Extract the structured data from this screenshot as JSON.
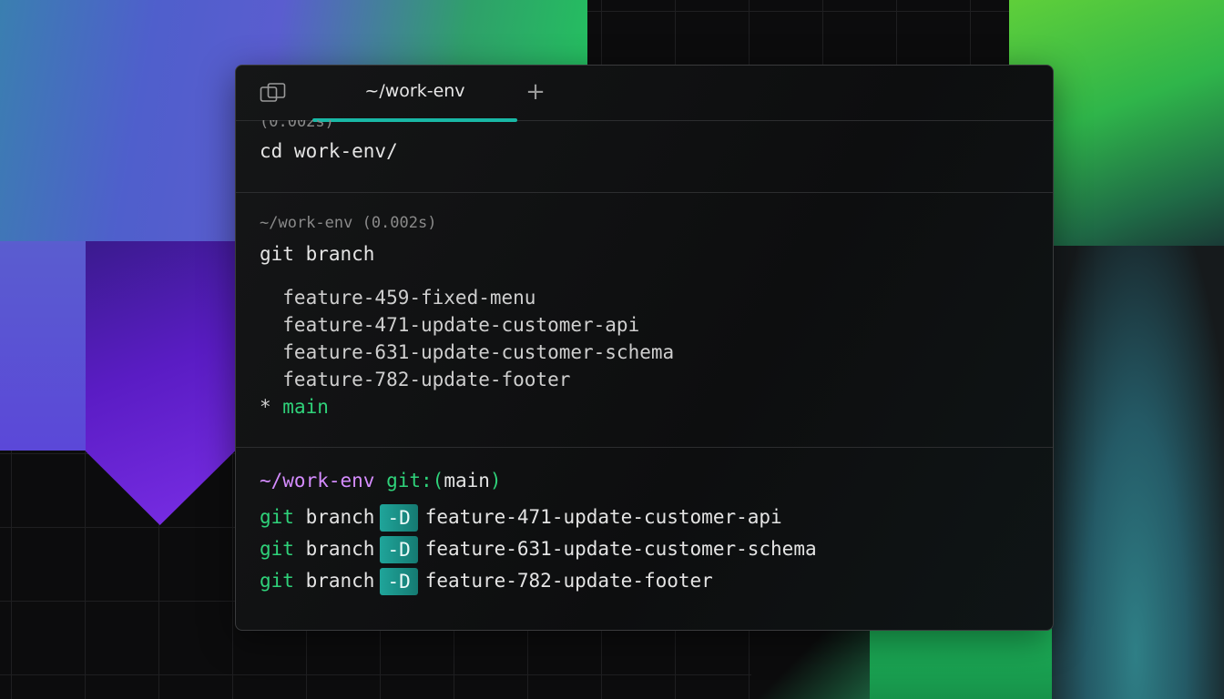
{
  "tabbar": {
    "tab_label": "~/work-env",
    "add_tab_label": "+"
  },
  "blocks": [
    {
      "meta": "(0.002s)",
      "command": "cd work-env/"
    },
    {
      "meta": "~/work-env (0.002s)",
      "command": "git branch",
      "output": [
        "  feature-459-fixed-menu",
        "  feature-471-update-customer-api",
        "  feature-631-update-customer-schema",
        "  feature-782-update-footer"
      ],
      "current_marker": "* ",
      "current_branch": "main"
    }
  ],
  "prompt": {
    "path": "~/work-env",
    "git_prefix": "git:(",
    "branch": "main",
    "git_suffix": ")"
  },
  "input_lines": [
    {
      "cmd": "git",
      "sub": "branch",
      "flag": "-D",
      "arg": "feature-471-update-customer-api"
    },
    {
      "cmd": "git",
      "sub": "branch",
      "flag": "-D",
      "arg": "feature-631-update-customer-schema"
    },
    {
      "cmd": "git",
      "sub": "branch",
      "flag": "-D",
      "arg": "feature-782-update-footer"
    }
  ],
  "colors": {
    "accent": "#19b8a6",
    "git_green": "#2fd27a",
    "path_purple": "#d58cff"
  }
}
